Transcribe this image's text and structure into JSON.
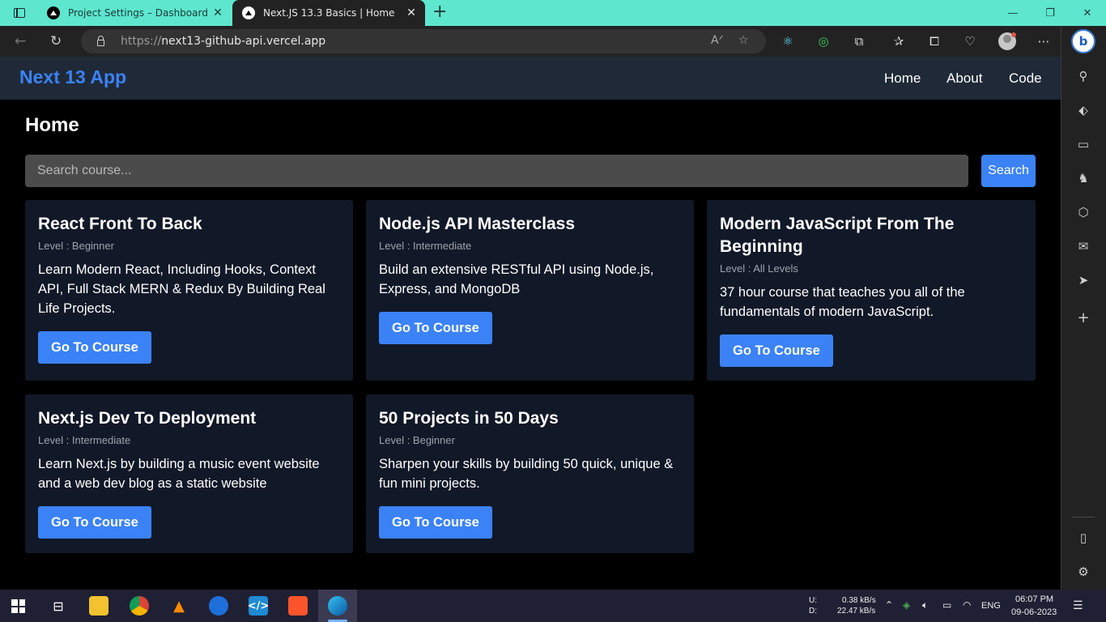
{
  "browser": {
    "tabs": [
      {
        "title": "Project Settings – Dashboard – V",
        "close": "✕",
        "active": false
      },
      {
        "title": "Next.JS 13.3 Basics | Home",
        "close": "✕",
        "active": true
      }
    ],
    "new_tab": "+",
    "window_controls": {
      "minimize": "—",
      "restore": "❐",
      "close": "✕"
    },
    "url_scheme": "https://",
    "url_host": "next13-github-api.vercel.app"
  },
  "site": {
    "brand": "Next 13 App",
    "nav": [
      "Home",
      "About",
      "Code"
    ],
    "page_title": "Home",
    "search": {
      "placeholder": "Search course...",
      "button": "Search"
    },
    "courses": [
      {
        "title": "React Front To Back",
        "level": "Level : Beginner",
        "description": "Learn Modern React, Including Hooks, Context API, Full Stack MERN & Redux By Building Real Life Projects.",
        "button": "Go To Course"
      },
      {
        "title": "Node.js API Masterclass",
        "level": "Level : Intermediate",
        "description": "Build an extensive RESTful API using Node.js, Express, and MongoDB",
        "button": "Go To Course"
      },
      {
        "title": "Modern JavaScript From The Beginning",
        "level": "Level : All Levels",
        "description": "37 hour course that teaches you all of the fundamentals of modern JavaScript.",
        "button": "Go To Course"
      },
      {
        "title": "Next.js Dev To Deployment",
        "level": "Level : Intermediate",
        "description": "Learn Next.js by building a music event website and a web dev blog as a static website",
        "button": "Go To Course"
      },
      {
        "title": "50 Projects in 50 Days",
        "level": "Level : Beginner",
        "description": "Sharpen your skills by building 50 quick, unique & fun mini projects.",
        "button": "Go To Course"
      }
    ]
  },
  "taskbar": {
    "net_up_label": "U:",
    "net_down_label": "D:",
    "net_up": "0.38 kB/s",
    "net_down": "22.47 kB/s",
    "language": "ENG",
    "time": "06:07 PM",
    "date": "09-06-2023"
  }
}
